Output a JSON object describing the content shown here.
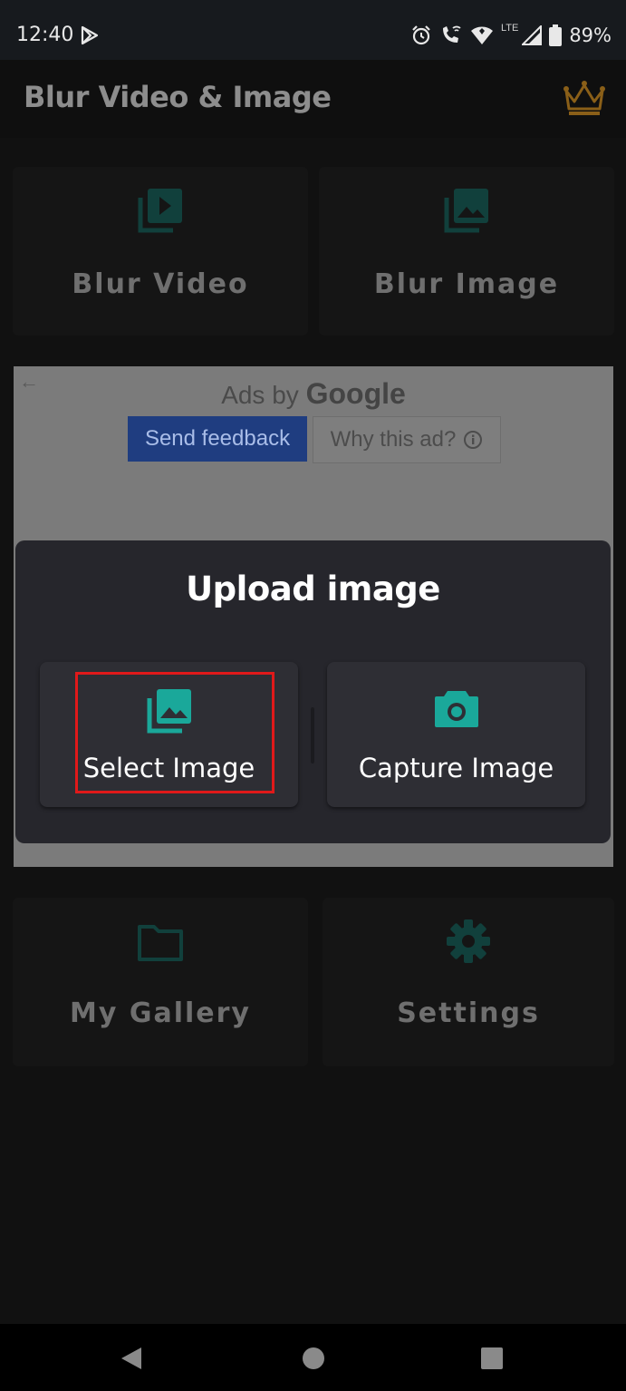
{
  "status_bar": {
    "time": "12:40",
    "network": "LTE",
    "battery": "89%"
  },
  "app_bar": {
    "title": "Blur Video & Image",
    "premium_icon": "crown-icon"
  },
  "tiles": {
    "blur_video": "Blur Video",
    "blur_image": "Blur Image",
    "my_gallery": "My Gallery",
    "settings": "Settings"
  },
  "ad": {
    "ads_by": "Ads by",
    "google": "Google",
    "send_feedback": "Send feedback",
    "why_this_ad": "Why this ad?"
  },
  "dialog": {
    "title": "Upload image",
    "select_image": "Select Image",
    "capture_image": "Capture Image"
  },
  "colors": {
    "accent": "#1aa89a",
    "highlight": "#e0191a",
    "background": "#111111"
  }
}
